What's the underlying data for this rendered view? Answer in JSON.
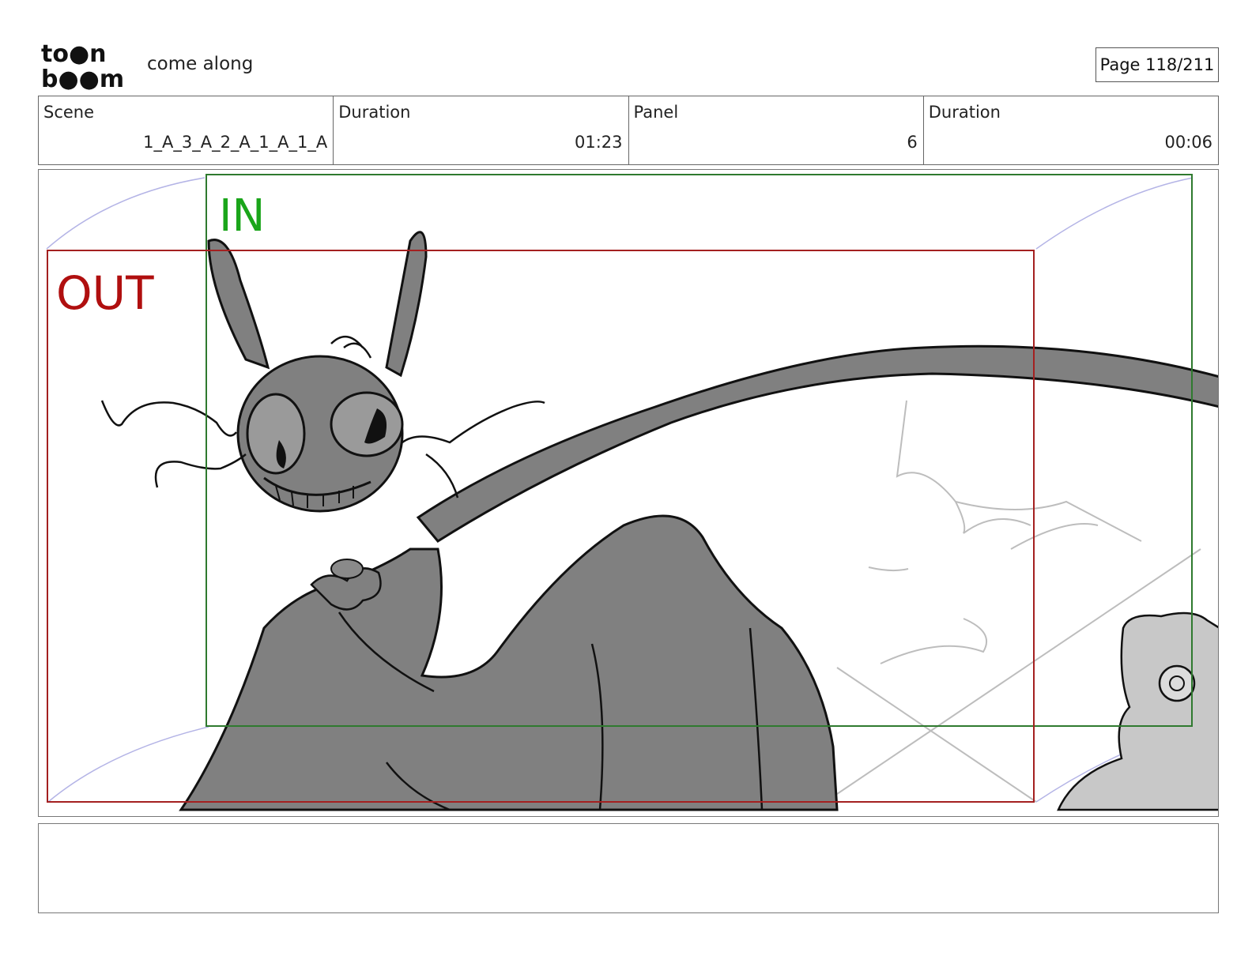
{
  "header": {
    "logo_line1": "to●n",
    "logo_line2": "b●●m",
    "project_title": "come along",
    "page_label": "Page 118/211"
  },
  "info": {
    "scene_label": "Scene",
    "scene_value": "1_A_3_A_2_A_1_A_1_A",
    "duration_label": "Duration",
    "duration_value": "01:23",
    "panel_label": "Panel",
    "panel_value": "6",
    "panel_duration_label": "Duration",
    "panel_duration_value": "00:06"
  },
  "panel": {
    "in_label": "IN",
    "out_label": "OUT",
    "in_color": "#1aa51a",
    "out_color": "#b00f0f",
    "character_fill": "#808080"
  },
  "notes": {
    "text": ""
  }
}
